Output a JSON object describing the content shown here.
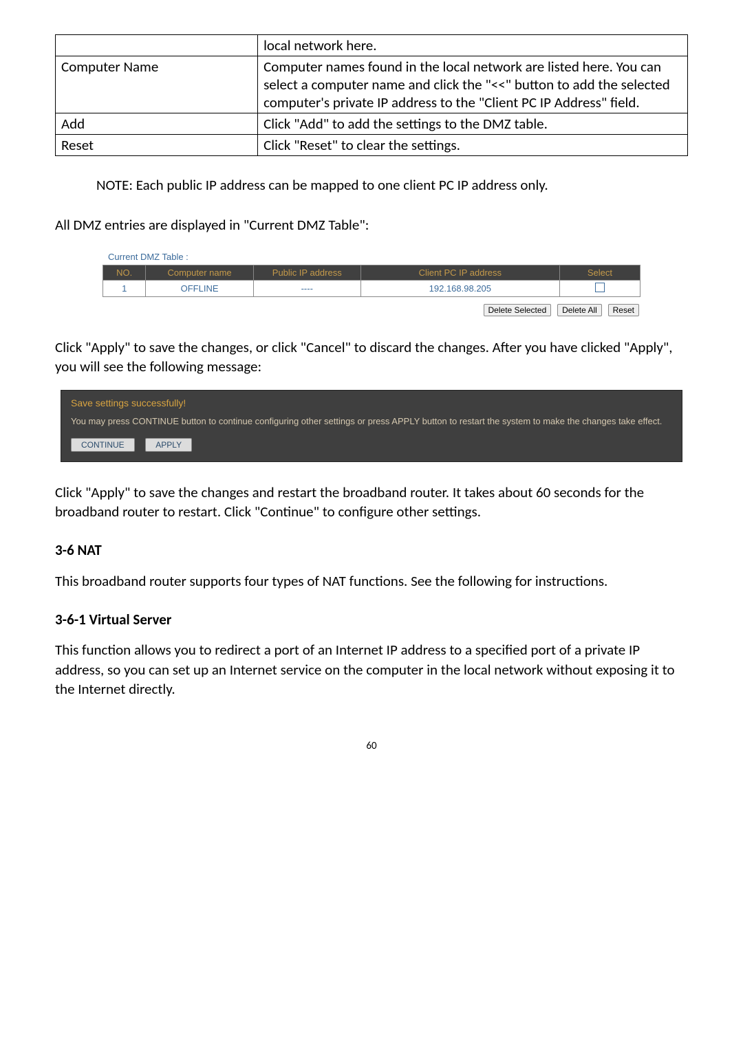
{
  "desc_table": {
    "rows": [
      {
        "k": "",
        "v": "local network here."
      },
      {
        "k": "Computer Name",
        "v": "Computer names found in the local network are listed here. You can select a computer name and click the \"<<\" button to add the selected computer's private IP address to the \"Client PC IP Address\" field."
      },
      {
        "k": "Add",
        "v": "Click \"Add\" to add the settings to the DMZ table."
      },
      {
        "k": "Reset",
        "v": "Click \"Reset\" to clear the settings."
      }
    ]
  },
  "note": "NOTE: Each public IP address can be mapped to one client PC IP address only.",
  "para1": "All DMZ entries are displayed in \"Current DMZ Table\":",
  "dmz": {
    "title": "Current DMZ Table :",
    "headers": {
      "no": "NO.",
      "comp": "Computer name",
      "pub": "Public IP address",
      "cli": "Client PC IP address",
      "sel": "Select"
    },
    "row": {
      "no": "1",
      "comp": "OFFLINE",
      "pub": "----",
      "cli": "192.168.98.205"
    },
    "buttons": {
      "del_sel": "Delete Selected",
      "del_all": "Delete All",
      "reset": "Reset"
    }
  },
  "para2": "Click \"Apply\" to save the changes, or click \"Cancel\" to discard the changes. After you have clicked \"Apply\", you will see the following message:",
  "save_panel": {
    "title": "Save settings successfully!",
    "msg": "You may press CONTINUE button to continue configuring other settings or press APPLY button to restart the system to make the changes take effect.",
    "continue": "CONTINUE",
    "apply": "APPLY"
  },
  "para3": "Click \"Apply\" to save the changes and restart the broadband router. It takes about 60 seconds for the broadband router to restart. Click \"Continue\" to configure other settings.",
  "h36": "3-6 NAT",
  "para4": "This broadband router supports four types of NAT functions. See the following for instructions.",
  "h361": "3-6-1 Virtual Server",
  "para5": "This function allows you to redirect a port of an Internet IP address to a specified port of a private IP address, so you can set up an Internet service on the computer in the local network without exposing it to the Internet directly.",
  "page_num": "60"
}
